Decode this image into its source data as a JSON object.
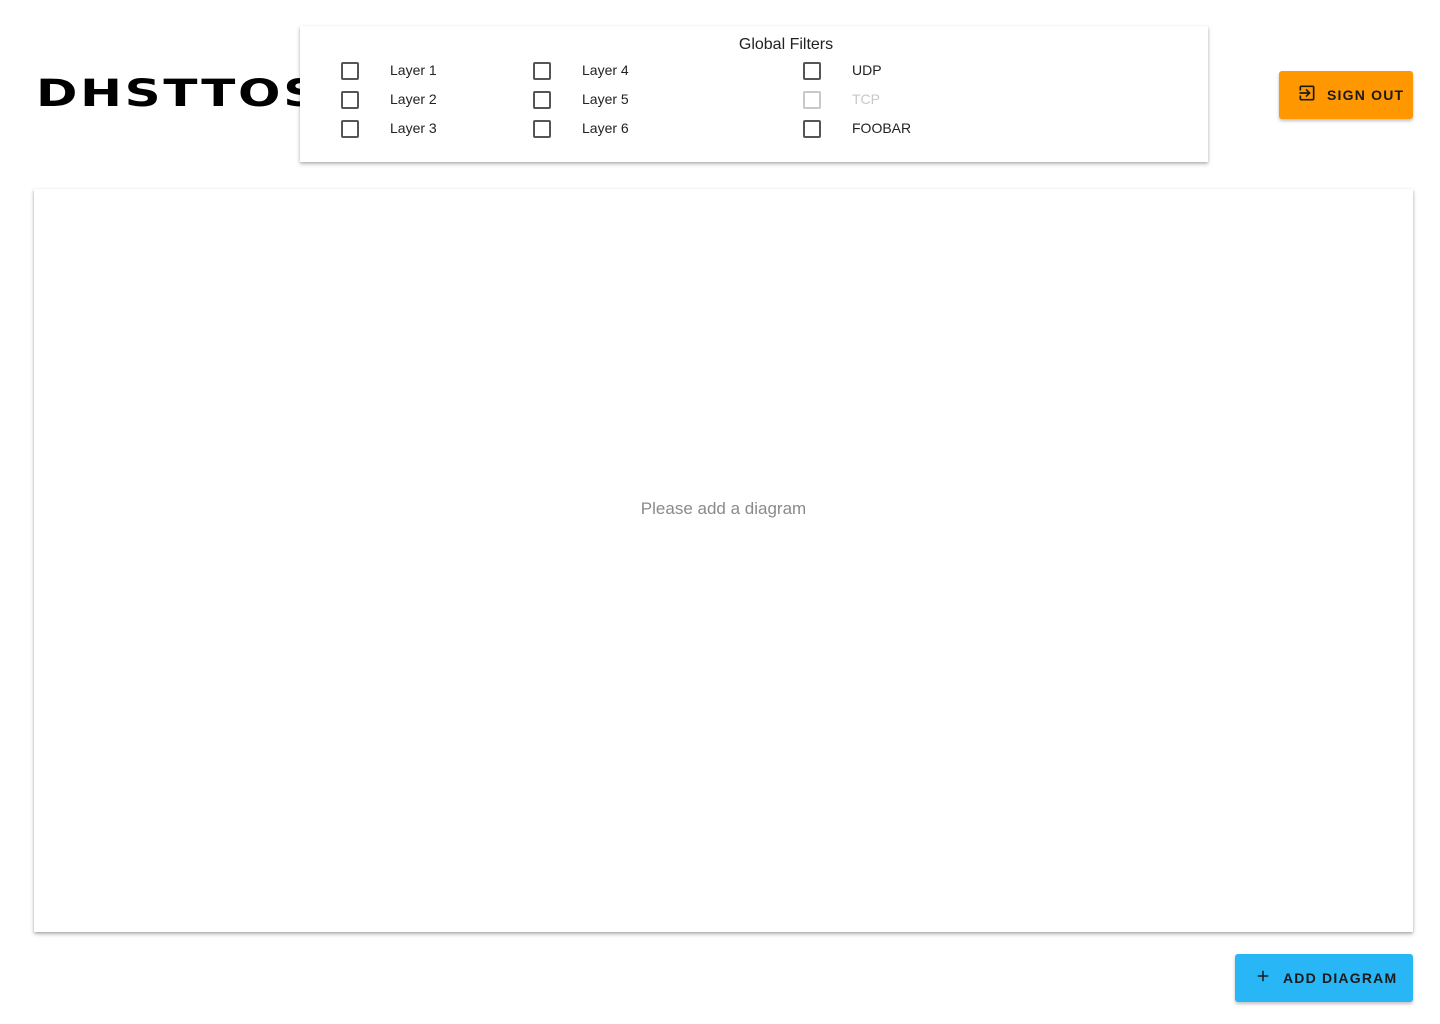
{
  "app": {
    "logo_text": "DHSTTOS"
  },
  "filters": {
    "title": "Global Filters",
    "items": [
      {
        "label": "Layer 1",
        "checked": false,
        "disabled": false
      },
      {
        "label": "Layer 2",
        "checked": false,
        "disabled": false
      },
      {
        "label": "Layer 3",
        "checked": false,
        "disabled": false
      },
      {
        "label": "Layer 4",
        "checked": false,
        "disabled": false
      },
      {
        "label": "Layer 5",
        "checked": false,
        "disabled": false
      },
      {
        "label": "Layer 6",
        "checked": false,
        "disabled": false
      },
      {
        "label": "UDP",
        "checked": false,
        "disabled": false
      },
      {
        "label": "TCP",
        "checked": false,
        "disabled": true
      },
      {
        "label": "FOOBAR",
        "checked": false,
        "disabled": false
      }
    ]
  },
  "header": {
    "sign_out_label": "SIGN OUT",
    "sign_out_icon": "exit-to-app-icon",
    "sign_out_color": "#ff9800"
  },
  "main": {
    "empty_message": "Please add a diagram"
  },
  "footer": {
    "add_diagram_label": "ADD DIAGRAM",
    "add_diagram_icon": "plus-icon",
    "add_diagram_color": "#29b6f6"
  }
}
